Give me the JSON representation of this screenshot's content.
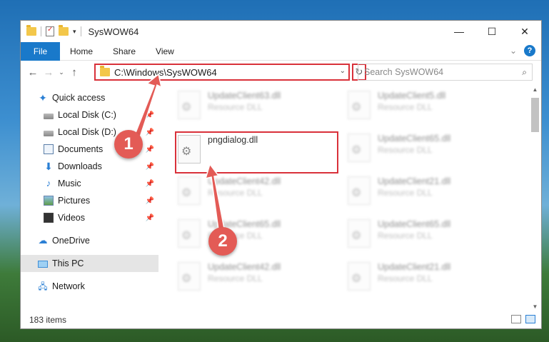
{
  "window": {
    "title": "SysWOW64",
    "controls": {
      "minimize": "—",
      "maximize": "☐",
      "close": "✕"
    }
  },
  "ribbon": {
    "file_tab": "File",
    "tabs": [
      "Home",
      "Share",
      "View"
    ]
  },
  "address_bar": {
    "path": "C:\\Windows\\SysWOW64",
    "search_placeholder": "Search SysWOW64"
  },
  "sidebar": {
    "items": [
      {
        "label": "Quick access",
        "icon": "star-icon",
        "pinned": false
      },
      {
        "label": "Local Disk (C:)",
        "icon": "disk-icon",
        "pinned": true
      },
      {
        "label": "Local Disk (D:)",
        "icon": "disk-icon",
        "pinned": true
      },
      {
        "label": "Documents",
        "icon": "documents-icon",
        "pinned": true
      },
      {
        "label": "Downloads",
        "icon": "downloads-icon",
        "pinned": true
      },
      {
        "label": "Music",
        "icon": "music-icon",
        "pinned": true
      },
      {
        "label": "Pictures",
        "icon": "pictures-icon",
        "pinned": true
      },
      {
        "label": "Videos",
        "icon": "videos-icon",
        "pinned": true
      },
      {
        "label": "OneDrive",
        "icon": "onedrive-icon",
        "pinned": false
      },
      {
        "label": "This PC",
        "icon": "this-pc-icon",
        "pinned": false,
        "selected": true
      },
      {
        "label": "Network",
        "icon": "network-icon",
        "pinned": false
      }
    ]
  },
  "files": {
    "left": [
      {
        "name": "UpdateClient63.dll",
        "desc": "Resource DLL"
      },
      {
        "name": "pngdialog.dll",
        "desc": ""
      },
      {
        "name": "UpdateClient42.dll",
        "desc": "Resource DLL"
      },
      {
        "name": "UpdateClient65.dll",
        "desc": "Resource DLL"
      },
      {
        "name": "UpdateClient42.dll",
        "desc": "Resource DLL"
      }
    ],
    "right": [
      {
        "name": "UpdateClient5.dll",
        "desc": "Resource DLL"
      },
      {
        "name": "UpdateClient65.dll",
        "desc": "Resource DLL"
      },
      {
        "name": "UpdateClient21.dll",
        "desc": "Resource DLL"
      },
      {
        "name": "UpdateClient65.dll",
        "desc": "Resource DLL"
      },
      {
        "name": "UpdateClient21.dll",
        "desc": "Resource DLL"
      }
    ]
  },
  "status": {
    "item_count": "183 items"
  },
  "callouts": {
    "step1": "1",
    "step2": "2"
  },
  "colors": {
    "accent": "#1979ca",
    "highlight": "#d9313a",
    "callout": "#e35b56"
  }
}
